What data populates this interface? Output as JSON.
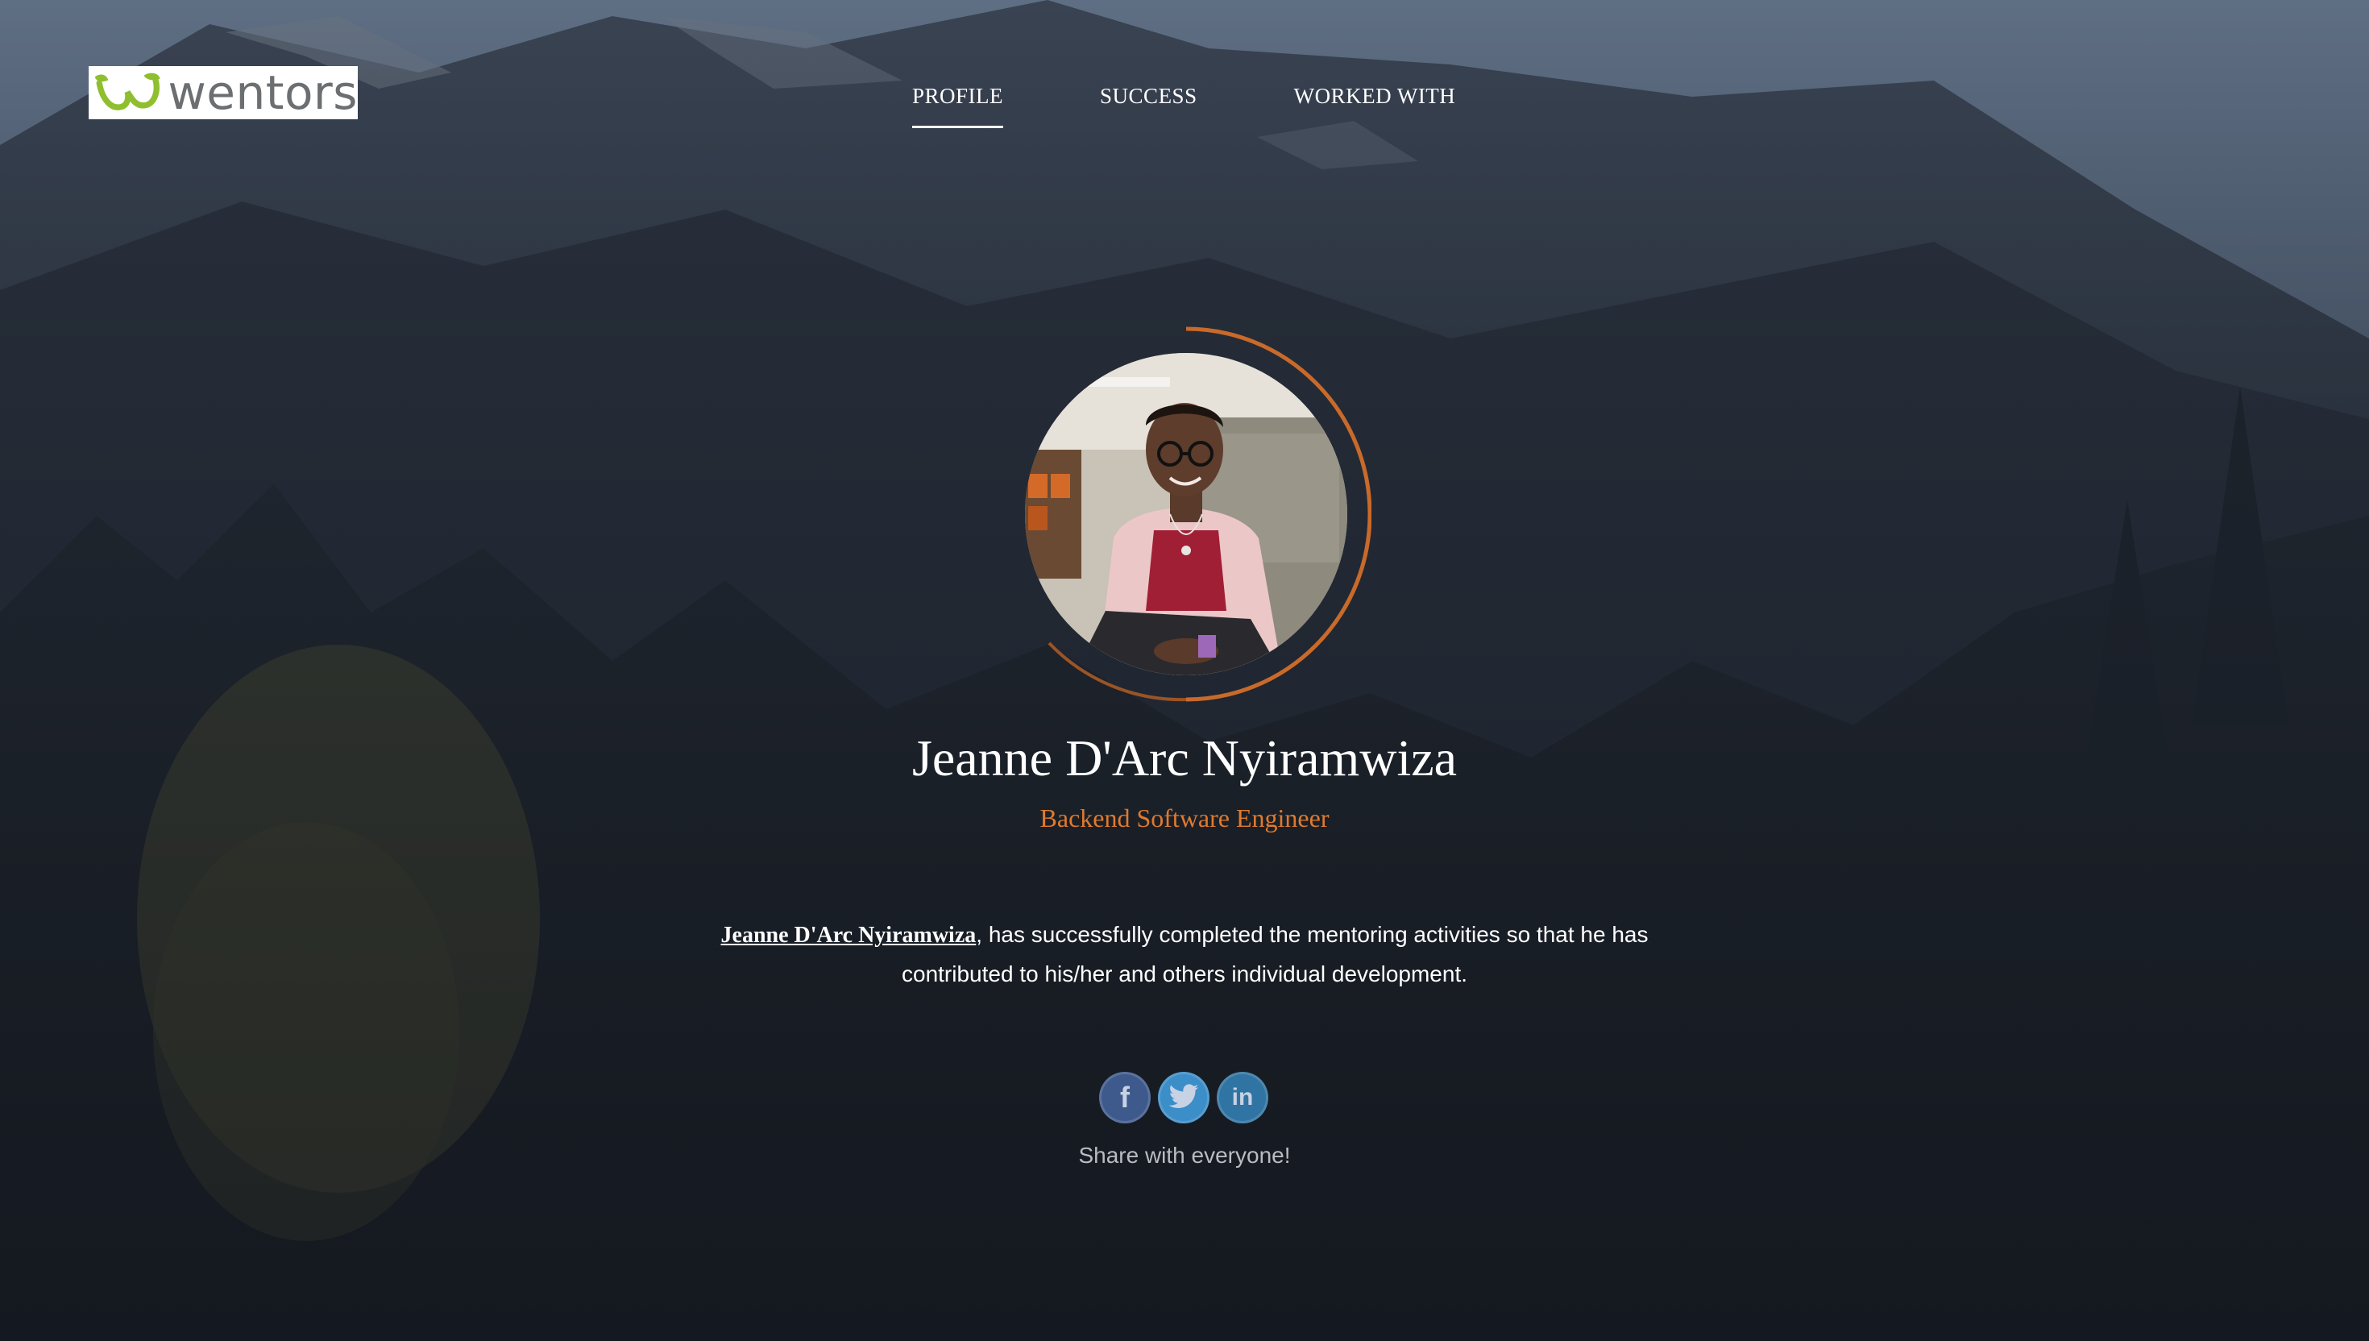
{
  "header": {
    "logo_text": "wentors",
    "nav": [
      {
        "label": "PROFILE",
        "active": true
      },
      {
        "label": "SUCCESS",
        "active": false
      },
      {
        "label": "WORKED WITH",
        "active": false
      }
    ]
  },
  "profile": {
    "name": "Jeanne D'Arc Nyiramwiza",
    "role": "Backend Software Engineer",
    "statement_name": "Jeanne D'Arc Nyiramwiza",
    "statement_rest": ", has successfully completed the mentoring activities so that he has contributed to his/her and others individual development."
  },
  "share": {
    "buttons": [
      {
        "icon": "facebook-icon",
        "glyph": "f"
      },
      {
        "icon": "twitter-icon",
        "glyph": ""
      },
      {
        "icon": "linkedin-icon",
        "glyph": "in"
      }
    ],
    "label": "Share with everyone!"
  },
  "colors": {
    "accent": "#e07a2e",
    "nav_text": "#ffffff",
    "background": "#1f2731"
  }
}
